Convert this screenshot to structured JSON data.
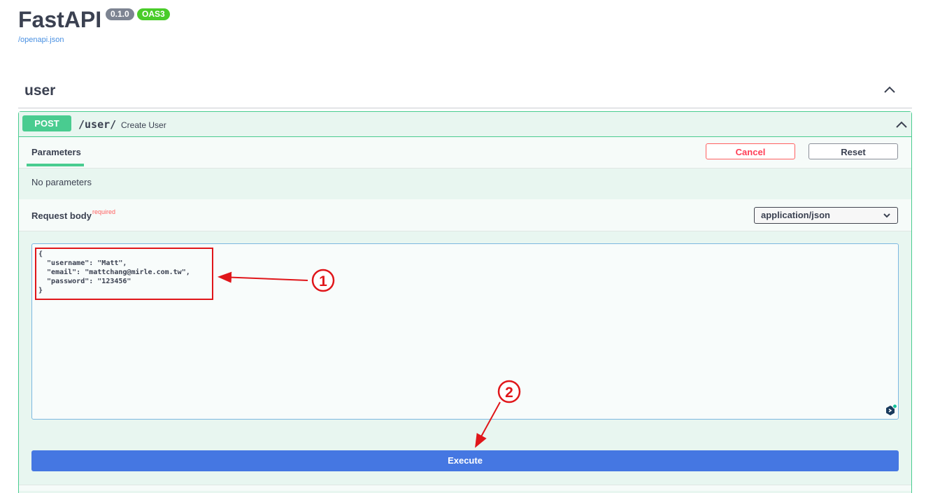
{
  "header": {
    "title": "FastAPI",
    "version_badge": "0.1.0",
    "oas_badge": "OAS3",
    "spec_link": "/openapi.json"
  },
  "tag": {
    "name": "user"
  },
  "operation": {
    "method": "POST",
    "path": "/user/",
    "summary": "Create User",
    "tabs": {
      "parameters": "Parameters"
    },
    "buttons": {
      "cancel": "Cancel",
      "reset": "Reset",
      "execute": "Execute"
    },
    "no_parameters_text": "No parameters",
    "request_body": {
      "label": "Request body",
      "required_label": "required",
      "content_type": "application/json",
      "body_text": "{\n  \"username\": \"Matt\",\n  \"email\": \"mattchang@mirle.com.tw\",\n  \"password\": \"123456\"\n}"
    }
  },
  "annotations": {
    "step1": "1",
    "step2": "2"
  },
  "colors": {
    "post_green": "#49cc90",
    "execute_blue": "#4577e2",
    "cancel_red": "#ff3d55",
    "annotation_red": "#e0161a"
  }
}
